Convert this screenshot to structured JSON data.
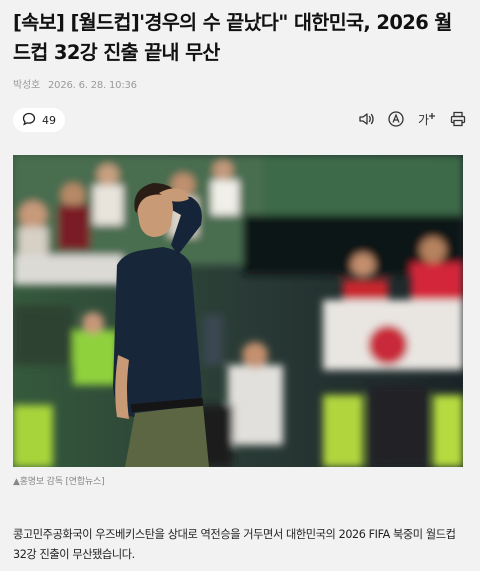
{
  "article": {
    "headline": "[속보] [월드컵]'경우의 수 끝났다\" 대한민국, 2026 월드컵 32강 진출 끝내 무산",
    "author": "박성호",
    "date": "2026. 6. 28. 10:36",
    "comment_count": "49",
    "photo_caption": "▲홍명보 감독 [연합뉴스]",
    "body": "콩고민주공화국이 우즈베키스탄을 상대로 역전승을 거두면서 대한민국의 2026 FIFA 북중미 월드컵 32강 진출이 무산됐습니다."
  },
  "toolbar": {
    "icons": [
      "audio-icon",
      "translate-icon",
      "font-size-icon",
      "print-icon"
    ],
    "font_size_label": "가"
  },
  "colors": {
    "background": "#f2f2f3",
    "muted_text": "#9a9a9a"
  }
}
